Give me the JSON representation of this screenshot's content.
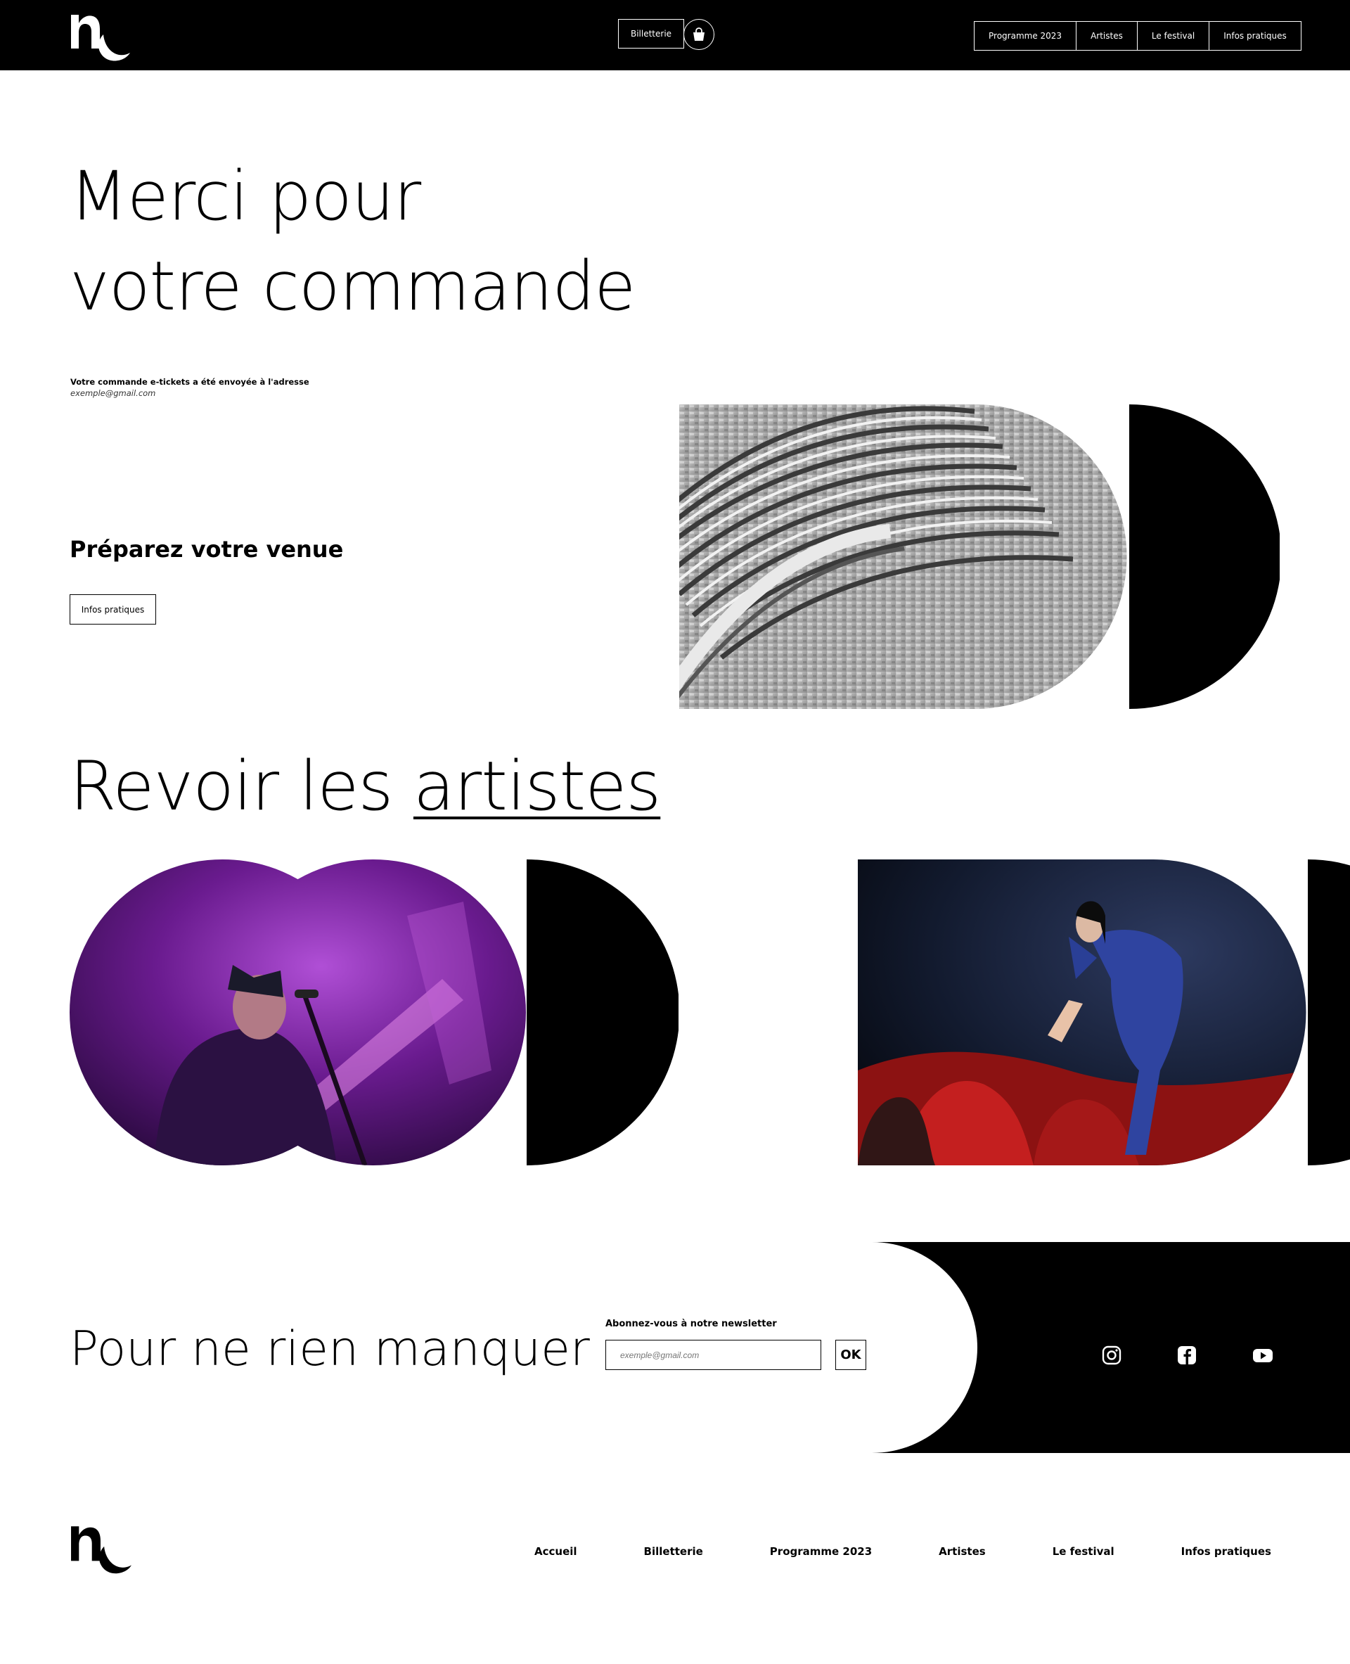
{
  "header": {
    "billetterie_label": "Billetterie",
    "nav": [
      "Programme 2023",
      "Artistes",
      "Le festival",
      "Infos pratiques"
    ]
  },
  "hero": {
    "title_line1": "Merci pour",
    "title_line2": "votre commande",
    "note": "Votre commande e-tickets a été envoyée à l'adresse",
    "email": "exemple@gmail.com"
  },
  "prepare": {
    "title": "Préparez votre venue",
    "button": "Infos pratiques"
  },
  "artists": {
    "title_plain": "Revoir les ",
    "title_link": "artistes"
  },
  "newsletter": {
    "title": "Pour ne rien manquer",
    "label": "Abonnez-vous à notre newsletter",
    "placeholder": "exemple@gmail.com",
    "ok": "OK"
  },
  "social": [
    "instagram-icon",
    "facebook-icon",
    "youtube-icon"
  ],
  "footer": {
    "nav": [
      "Accueil",
      "Billetterie",
      "Programme 2023",
      "Artistes",
      "Le festival",
      "Infos pratiques"
    ]
  },
  "colors": {
    "black": "#000000",
    "white": "#ffffff"
  }
}
